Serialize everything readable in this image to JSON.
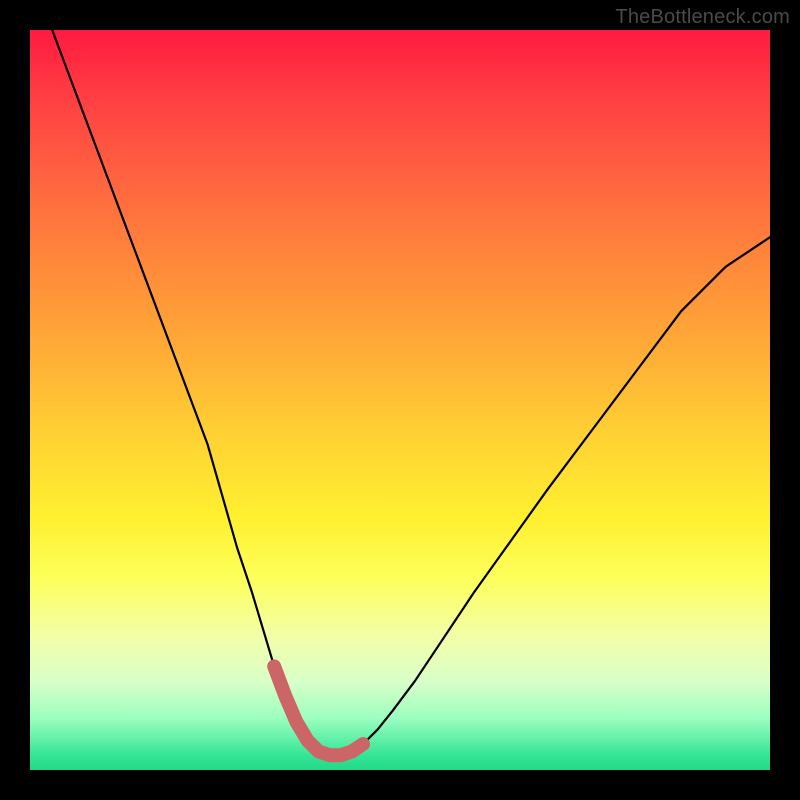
{
  "watermark": "TheBottleneck.com",
  "colors": {
    "frame": "#000000",
    "curve": "#000000",
    "marker": "#cc6666"
  },
  "chart_data": {
    "type": "line",
    "title": "",
    "xlabel": "",
    "ylabel": "",
    "xlim": [
      0,
      100
    ],
    "ylim": [
      0,
      100
    ],
    "series": [
      {
        "name": "black-curve",
        "x": [
          3,
          6,
          9,
          12,
          15,
          18,
          21,
          24,
          26,
          28,
          30,
          31.5,
          33,
          34.5,
          36,
          37.5,
          39,
          40.5,
          42,
          43.5,
          45,
          47,
          49,
          52,
          56,
          60,
          65,
          70,
          76,
          82,
          88,
          94,
          100
        ],
        "y": [
          100,
          92,
          84,
          76,
          68,
          60,
          52,
          44,
          37,
          30,
          24,
          19,
          14,
          10,
          6.5,
          4,
          2.5,
          2,
          2,
          2.5,
          3.5,
          5.5,
          8,
          12,
          18,
          24,
          31,
          38,
          46,
          54,
          62,
          68,
          72
        ]
      },
      {
        "name": "pink-markers",
        "x": [
          33,
          34.5,
          36,
          37.5,
          39,
          40.5,
          42,
          43.5,
          45
        ],
        "y": [
          14,
          10,
          6.5,
          4,
          2.5,
          2,
          2,
          2.5,
          3.5
        ]
      }
    ]
  }
}
